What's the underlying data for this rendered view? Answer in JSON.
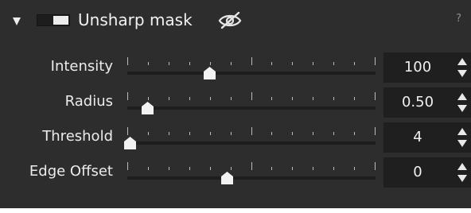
{
  "panel": {
    "title": "Unsharp mask",
    "help": "?",
    "enabled": true,
    "icons": {
      "collapse": "triangle-down-icon",
      "visibility": "eye-slash-icon"
    }
  },
  "rows": [
    {
      "label": "Intensity",
      "value": "100",
      "slider_fraction": 0.33
    },
    {
      "label": "Radius",
      "value": "0.50",
      "slider_fraction": 0.08
    },
    {
      "label": "Threshold",
      "value": "4",
      "slider_fraction": 0.01
    },
    {
      "label": "Edge Offset",
      "value": "0",
      "slider_fraction": 0.4
    }
  ],
  "colors": {
    "panel_background": "#2d2d2d",
    "field_background": "#1f1f1f",
    "text": "#ececec"
  }
}
